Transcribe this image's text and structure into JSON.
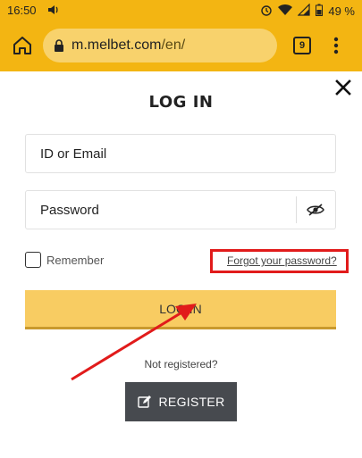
{
  "status_bar": {
    "time": "16:50",
    "battery": "49 %",
    "icons": [
      "volume-icon",
      "alarm-icon",
      "wifi-icon",
      "signal-icon",
      "battery-icon"
    ]
  },
  "browser": {
    "url_domain": "m.melbet.com",
    "url_path": "/en/",
    "tab_count": "9",
    "toolbar_color": "#f3b512"
  },
  "login_modal": {
    "title": "LOG IN",
    "id_placeholder": "ID or Email",
    "password_placeholder": "Password",
    "remember_label": "Remember",
    "remember_checked": false,
    "forgot_password_link": "Forgot your password?",
    "login_button": "LOG IN",
    "not_registered_text": "Not registered?",
    "register_button": "REGISTER",
    "accent_color": "#f8cc62",
    "register_button_color": "#474a4f"
  },
  "annotations": {
    "highlight_color": "#e11b1b"
  }
}
